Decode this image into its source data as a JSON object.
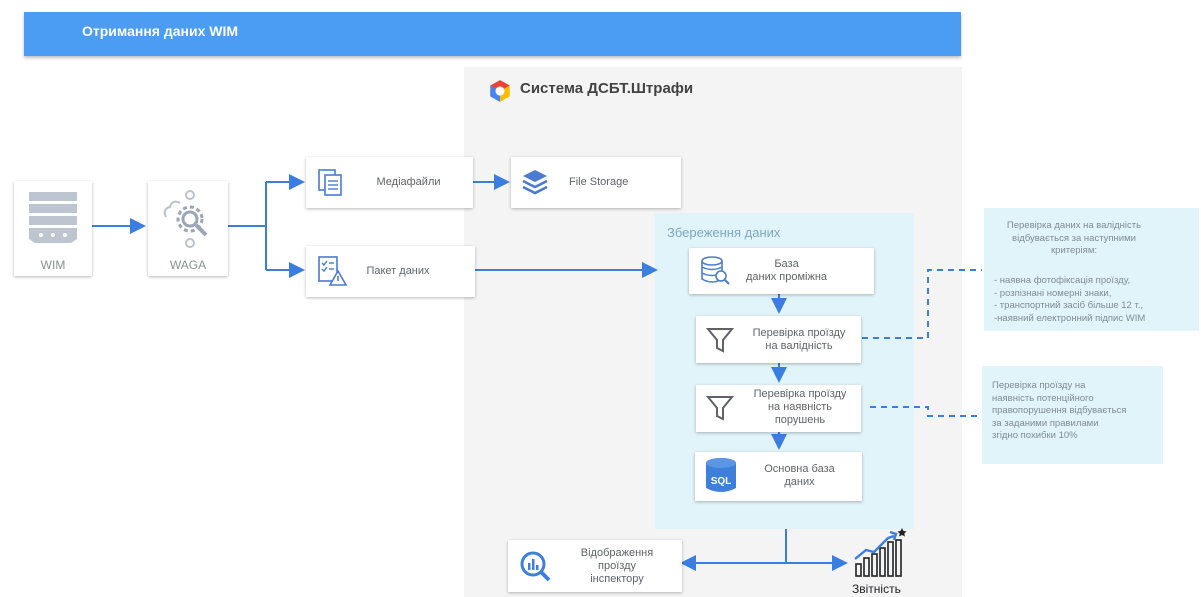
{
  "header": {
    "title": "Отримання даних WIM"
  },
  "system": {
    "title": "Система ДСБТ.Штрафи"
  },
  "sources": {
    "wim": {
      "label": "WIM"
    },
    "waga": {
      "label": "WAGA"
    }
  },
  "nodes": {
    "media_files": {
      "label": "Медіафайли"
    },
    "file_storage": {
      "label": "File Storage"
    },
    "data_packet": {
      "label": "Пакет даних"
    },
    "staging_db": {
      "line1": "База",
      "line2": "даних проміжна"
    },
    "validity_check": {
      "line1": "Перевірка проїзду",
      "line2": "на валідність"
    },
    "violation_check": {
      "line1": "Перевірка проїзду",
      "line2": "на наявність",
      "line3": "порушень"
    },
    "main_db": {
      "line1": "Основна база",
      "line2": "даних",
      "icon_text": "SQL"
    },
    "inspector_view": {
      "line1": "Відображення",
      "line2": "проїзду",
      "line3": "інспектору"
    }
  },
  "storage": {
    "title": "Збереження даних"
  },
  "notes": {
    "validity": {
      "line1": "Перевірка даних на валідність",
      "line2": "відбувається за наступними",
      "line3": "критеріям:",
      "line4": "- наявна фотофіксація проїзду,",
      "line5": "- розпізнані номерні знаки,",
      "line6": "- транспортний засіб більше 12 т.,",
      "line7": "-наявний електронний підпис WIM"
    },
    "violation": {
      "line1": "Перевірка проїзду на",
      "line2": "наявність потенційного",
      "line3": "правопорушення відбувається",
      "line4": "за заданими правилами",
      "line5": "згідно похибки 10%"
    }
  },
  "reports": {
    "label": "Звітність"
  },
  "colors": {
    "header": "#4a9df2",
    "connector": "#3a7ee0",
    "panel_bg": "#f4f4f4",
    "storage_bg": "#e1f4fa"
  }
}
